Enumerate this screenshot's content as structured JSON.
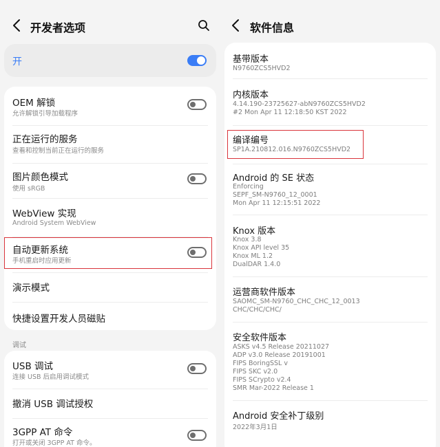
{
  "left": {
    "title": "开发者选项",
    "master_label": "开",
    "rows": [
      {
        "title": "OEM 解锁",
        "subtitle": "允许解锁引导加载程序"
      },
      {
        "title": "正在运行的服务",
        "subtitle": "查看和控制当前正在运行的服务"
      },
      {
        "title": "图片颜色模式",
        "subtitle": "使用 sRGB"
      },
      {
        "title": "WebView 实现",
        "subtitle": "Android System WebView"
      },
      {
        "title": "自动更新系统",
        "subtitle": "手机重启时应用更新"
      },
      {
        "title": "演示模式"
      },
      {
        "title": "快捷设置开发人员磁贴"
      }
    ],
    "debug_section": "调试",
    "debug_rows": [
      {
        "title": "USB 调试",
        "subtitle": "连接 USB 后启用调试模式"
      },
      {
        "title": "撤消 USB 调试授权"
      },
      {
        "title": "3GPP AT 命令",
        "subtitle": "打开或关闭 3GPP AT 命令。"
      }
    ]
  },
  "right": {
    "title": "软件信息",
    "items": [
      {
        "title": "基带版本",
        "lines": [
          "N9760ZCS5HVD2"
        ]
      },
      {
        "title": "内核版本",
        "lines": [
          "4.14.190-23725627-abN9760ZCS5HVD2",
          "#2 Mon Apr 11 12:18:50 KST 2022"
        ]
      },
      {
        "title": "编译编号",
        "lines": [
          "SP1A.210812.016.N9760ZCS5HVD2"
        ]
      },
      {
        "title": "Android 的 SE 状态",
        "lines": [
          "Enforcing",
          "SEPF_SM-N9760_12_0001",
          "Mon Apr 11 12:15:51 2022"
        ]
      },
      {
        "title": "Knox 版本",
        "lines": [
          "Knox 3.8",
          "Knox API level 35",
          "Knox ML 1.2",
          "DualDAR 1.4.0"
        ]
      },
      {
        "title": "运营商软件版本",
        "lines": [
          "SAOMC_SM-N9760_CHC_CHC_12_0013",
          "CHC/CHC/CHC/"
        ]
      },
      {
        "title": "安全软件版本",
        "lines": [
          "ASKS v4.5 Release 20211027",
          "ADP v3.0 Release 20191001",
          "FIPS BoringSSL v",
          "FIPS SKC v2.0",
          "FIPS SCrypto v2.4",
          "SMR Mar-2022 Release 1"
        ]
      },
      {
        "title": "Android 安全补丁级别",
        "lines": [
          "2022年3月1日"
        ]
      }
    ]
  },
  "colors": {
    "accent": "#3a7df6",
    "highlight": "#d9333a",
    "bg": "#f4f4f4",
    "card": "#ffffff"
  },
  "icons": {
    "back": "chevron-left-icon",
    "search": "search-icon"
  },
  "toggles": {
    "master": true,
    "oem_unlock": false,
    "color_mode": false,
    "auto_update": false,
    "usb_debug": false,
    "at_commands": false
  }
}
